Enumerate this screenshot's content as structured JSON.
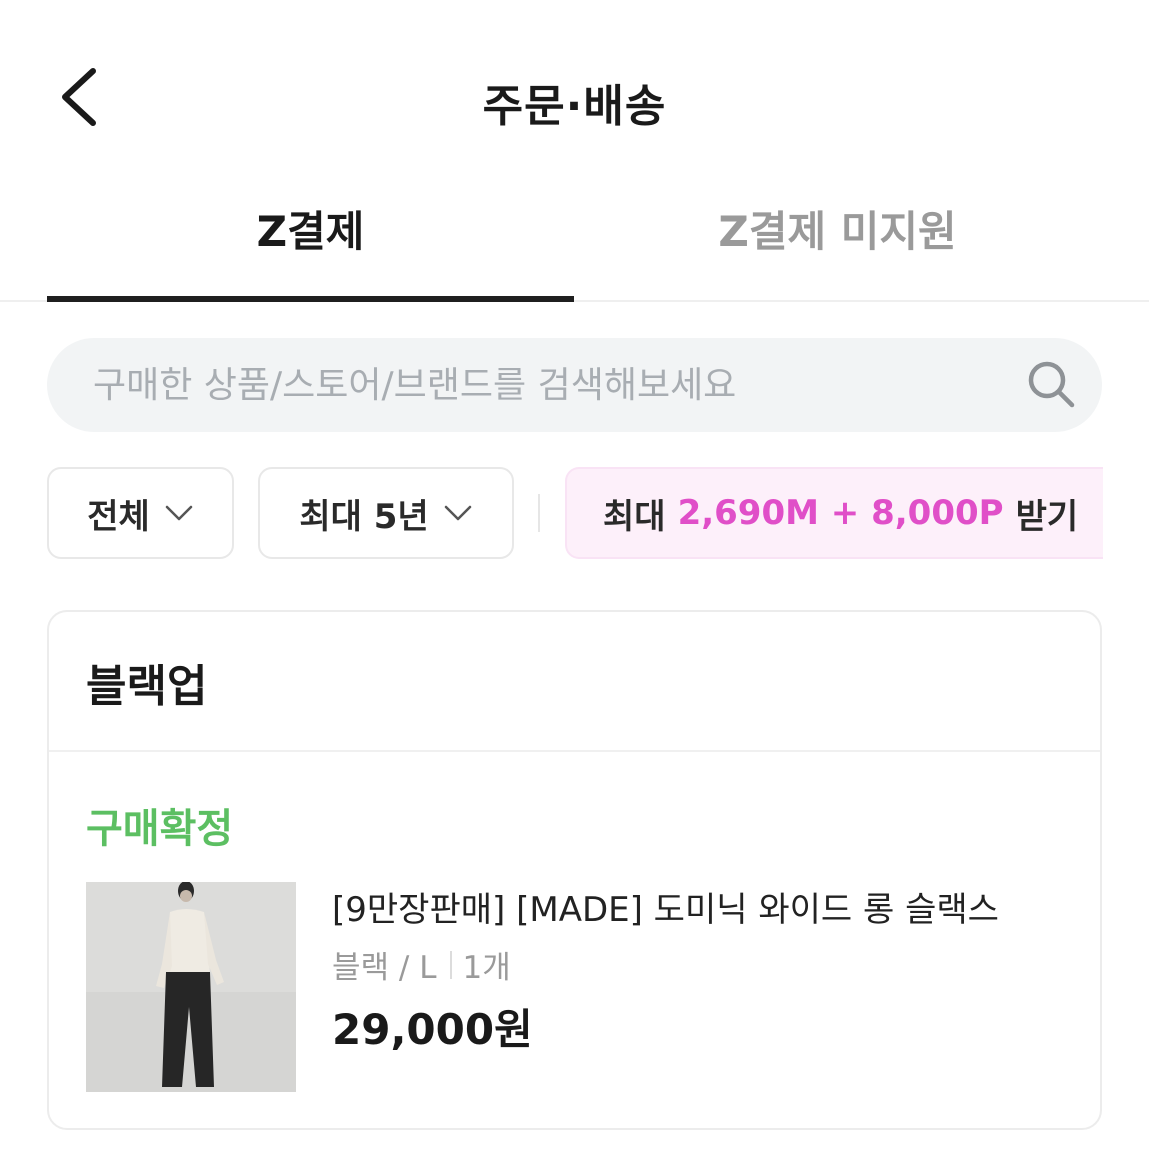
{
  "header": {
    "title": "주문·배송"
  },
  "tabs": [
    {
      "label": "Z결제"
    },
    {
      "label": "Z결제 미지원"
    }
  ],
  "search": {
    "placeholder": "구매한 상품/스토어/브랜드를 검색해보세요",
    "value": ""
  },
  "filters": {
    "category": "전체",
    "period": "최대 5년"
  },
  "promo": {
    "prefix": "최대",
    "highlight": "2,690M + 8,000P",
    "suffix": "받기",
    "highlight_color": "#e04fc8"
  },
  "order": {
    "store_name": "블랙업",
    "status": "구매확정",
    "status_color": "#5cbf62",
    "product": {
      "name": "[9만장판매] [MADE] 도미닉 와이드 롱 슬랙스",
      "option": "블랙 / L",
      "quantity": "1개",
      "price": "29,000원"
    }
  }
}
